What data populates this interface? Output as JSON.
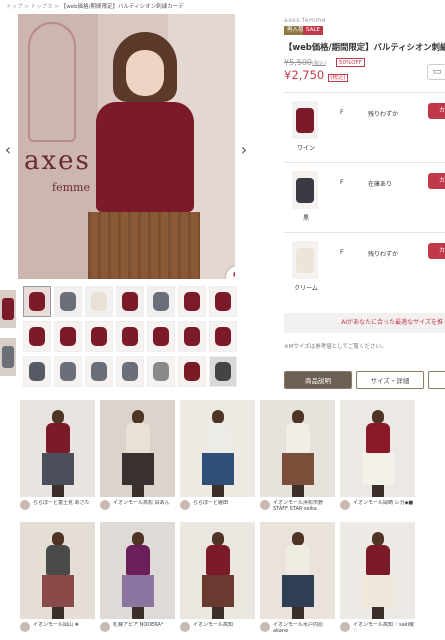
{
  "breadcrumb": {
    "items": [
      "トップ",
      "トップス"
    ],
    "sep": ">",
    "current": "【web価格/期間限定】バルティシオン刺繍カーデ"
  },
  "main_image": {
    "brand_name": "axes",
    "brand_sub": "femme",
    "prev": "‹",
    "next": "›",
    "fav_icon": "heart-icon",
    "fav_glyph": "♥"
  },
  "thumbnails": [
    {
      "color": "#7b1a28",
      "bg": "#eadcd8"
    },
    {
      "color": "#6b6f7a",
      "bg": "#f3f1ef"
    },
    {
      "color": "#e9e1d6",
      "bg": "#f3f1ef"
    },
    {
      "color": "#7b1a28",
      "bg": "#f3f1ef"
    },
    {
      "color": "#6b6f7a",
      "bg": "#f3f1ef"
    },
    {
      "color": "#7b1a28",
      "bg": "#f5f2f0"
    },
    {
      "color": "#7b1a28",
      "bg": "#f5f2f0"
    },
    {
      "color": "#7b1a28",
      "bg": "#f5f2f0"
    },
    {
      "color": "#7b1a28",
      "bg": "#f5f2f0"
    },
    {
      "color": "#7b1a28",
      "bg": "#f5f2f0"
    },
    {
      "color": "#7b1a28",
      "bg": "#f5f2f0"
    },
    {
      "color": "#7b1a28",
      "bg": "#f5f2f0"
    },
    {
      "color": "#7b1a28",
      "bg": "#f5f2f0"
    },
    {
      "color": "#7b1a28",
      "bg": "#f5f2f0"
    },
    {
      "color": "#555a64",
      "bg": "#f5f2f0"
    },
    {
      "color": "#6b6f7a",
      "bg": "#f5f2f0"
    },
    {
      "color": "#6b6f7a",
      "bg": "#f5f2f0"
    },
    {
      "color": "#6b6f7a",
      "bg": "#f5f2f0"
    },
    {
      "color": "#8a8a8a",
      "bg": "#f5f2f0"
    },
    {
      "color": "#7a1a24",
      "bg": "#f5f2f0"
    },
    {
      "color": "#444444",
      "bg": "#d9d9d9"
    }
  ],
  "product": {
    "brand": "axes femme",
    "badge_resale": "再入荷",
    "badge_sale": "SALE",
    "title": "【web価格/期間限定】バルティシオン刺繍カーデ",
    "old_price": "¥5,500",
    "old_price_tax": "(税込)",
    "off_badge": "50%OFF",
    "new_price": "¥2,750",
    "new_price_tax": "(税込)",
    "cart_icon": "cart-icon",
    "accent": "#c0394b"
  },
  "variants": [
    {
      "name": "ワイン",
      "size": "F",
      "stock": "残りわずか",
      "cart": "カ",
      "color": "#7b1a28"
    },
    {
      "name": "黒",
      "size": "F",
      "stock": "在庫あり",
      "cart": "カ",
      "color": "#3a3a44"
    },
    {
      "name": "クリーム",
      "size": "F",
      "stock": "残りわずか",
      "cart": "カ",
      "color": "#ede5d8"
    }
  ],
  "ai_banner": "AIがあなたに合った最適なサイズを推",
  "size_note": "※Mサイズは参考値としてご覧ください。",
  "tabs": [
    "商品説明",
    "サイズ・詳細",
    ""
  ],
  "coordinates": [
    {
      "user": "ららぽーと富士見 あさた",
      "top": "#7b1a28",
      "skirt": "#4a4f5a",
      "bg": "#e9e4df"
    },
    {
      "user": "イオンモール高松 白あん",
      "top": "#e8e2d4",
      "skirt": "#3a3030",
      "bg": "#dcd4cc"
    },
    {
      "user": "ららぽーと磐田",
      "top": "#ecebe6",
      "skirt": "#2f4f7a",
      "bg": "#efe9e4"
    },
    {
      "user": "イオンモール浜松市野 STAFF STAR seika",
      "top": "#f2eee6",
      "skirt": "#7a4f3a",
      "bg": "#e7e2dc"
    },
    {
      "user": "イオンモール岡崎 レガ◆■",
      "top": "#8a1a2a",
      "skirt": "#f4f0ea",
      "bg": "#ece8e4"
    },
    {
      "user": "イオンモール岡山 ❖",
      "top": "#4a4a4a",
      "skirt": "#8a4a4a",
      "bg": "#e5ded6"
    },
    {
      "user": "札幌アピア NODERA*",
      "top": "#6a1f5a",
      "skirt": "#8a76a0",
      "bg": "#e0dad6"
    },
    {
      "user": "イオンモール高知",
      "top": "#7b1a28",
      "skirt": "#6a3a30",
      "bg": "#ece6e0"
    },
    {
      "user": "イオンモール水戸内原 akane",
      "top": "#f0ece2",
      "skirt": "#2e3f55",
      "bg": "#e9e3dc"
    },
    {
      "user": "イオンモール高知 ♡saki曜♡",
      "top": "#7b1a28",
      "skirt": "#efe7da",
      "bg": "#ede9e5"
    }
  ]
}
